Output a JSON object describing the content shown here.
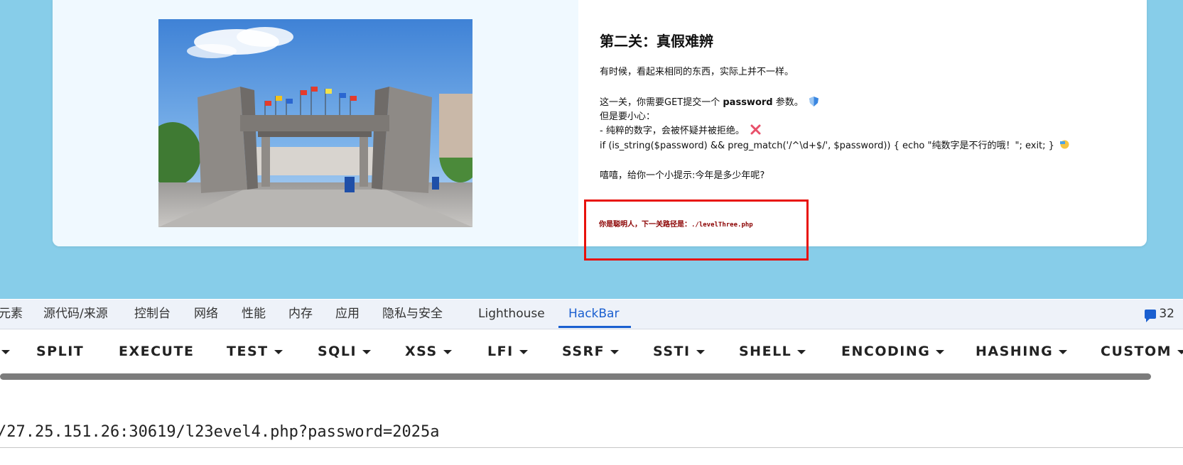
{
  "page": {
    "level_title": "第二关：真假难辨",
    "line1": "有时候，看起来相同的东西，实际上并不一样。",
    "line2_prefix": "这一关，你需要GET提交一个 ",
    "line2_bold": "password",
    "line2_suffix": " 参数。",
    "line3": "但是要小心：",
    "line4": "- 纯粹的数字，会被怀疑并被拒绝。",
    "line5": "if (is_string($password) && preg_match('/^\\d+$/', $password)) { echo \"纯数字是不行的哦！\"; exit; }",
    "line6": "嘻嘻，给你一个小提示:今年是多少年呢?",
    "hint_label": "你是聪明人，下一关路径是：",
    "hint_path": "./levelThree.php",
    "photo_icon": "campus-gate-photo",
    "accent_color": "#e8120c"
  },
  "devtools": {
    "tabs": [
      "元素",
      "源代码/来源",
      "控制台",
      "网络",
      "性能",
      "内存",
      "应用",
      "隐私与安全",
      "Lighthouse",
      "HackBar"
    ],
    "active_tab": "HackBar",
    "issues_icon": "message-icon",
    "issues_count": "32"
  },
  "hackbar": {
    "menu": [
      "SPLIT",
      "EXECUTE",
      "TEST",
      "SQLI",
      "XSS",
      "LFI",
      "SSRF",
      "SSTI",
      "SHELL",
      "ENCODING",
      "HASHING",
      "CUSTOM"
    ],
    "url_value": "/27.25.151.26:30619/l23evel4.php?password=2025a"
  }
}
